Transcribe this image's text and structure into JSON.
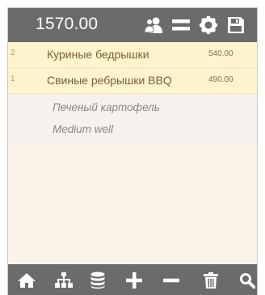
{
  "header": {
    "total": "1570.00",
    "icons": [
      "users-icon",
      "menu-icon",
      "settings-icon",
      "save-icon"
    ]
  },
  "order": {
    "items": [
      {
        "qty": "2",
        "name": "Куриные бедрышки",
        "price": "540.00"
      },
      {
        "qty": "1",
        "name": "Свиные ребрышки BBQ",
        "price": "490.00"
      }
    ],
    "modifiers": [
      "Печеный картофель",
      "Medium well"
    ]
  },
  "toolbar": {
    "icons": [
      "home-icon",
      "hierarchy-icon",
      "database-icon",
      "plus-icon",
      "minus-icon",
      "trash-icon",
      "search-icon"
    ]
  },
  "colors": {
    "bar": "#6b6b6b",
    "row_highlight": "#fdf3cc",
    "background": "#faf4e8"
  }
}
